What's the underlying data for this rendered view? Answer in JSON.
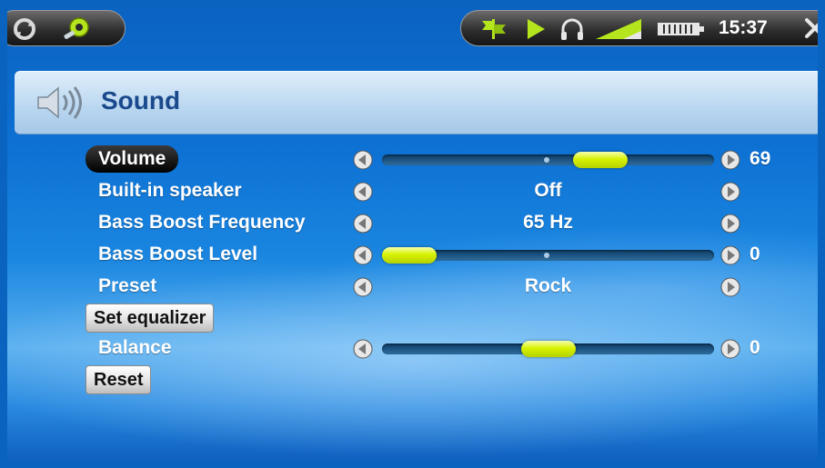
{
  "status_bar": {
    "icons": [
      "refresh-icon",
      "settings-icon",
      "flag-icon",
      "play-icon",
      "headphones-icon",
      "volume-level-icon",
      "battery-icon",
      "close-icon"
    ],
    "time": "15:37",
    "accent_color": "#b5e61d"
  },
  "header": {
    "icon": "speaker-icon",
    "title": "Sound"
  },
  "settings": {
    "volume": {
      "label": "Volume",
      "value": "69",
      "level": 0.69
    },
    "builtin_speaker": {
      "label": "Built-in speaker",
      "value": "Off"
    },
    "bass_boost_frequency": {
      "label": "Bass Boost Frequency",
      "value": "65 Hz"
    },
    "bass_boost_level": {
      "label": "Bass Boost Level",
      "value": "0",
      "level": 0.0
    },
    "preset": {
      "label": "Preset",
      "value": "Rock"
    },
    "set_equalizer": {
      "label": "Set equalizer"
    },
    "balance": {
      "label": "Balance",
      "value": "0",
      "level": 0.5
    },
    "reset": {
      "label": "Reset"
    }
  },
  "colors": {
    "slider_thumb": "#d7f200",
    "slider_track": "#1f5a8a",
    "selected_item_bg": "#000000",
    "header_title": "#1a4a8c"
  }
}
